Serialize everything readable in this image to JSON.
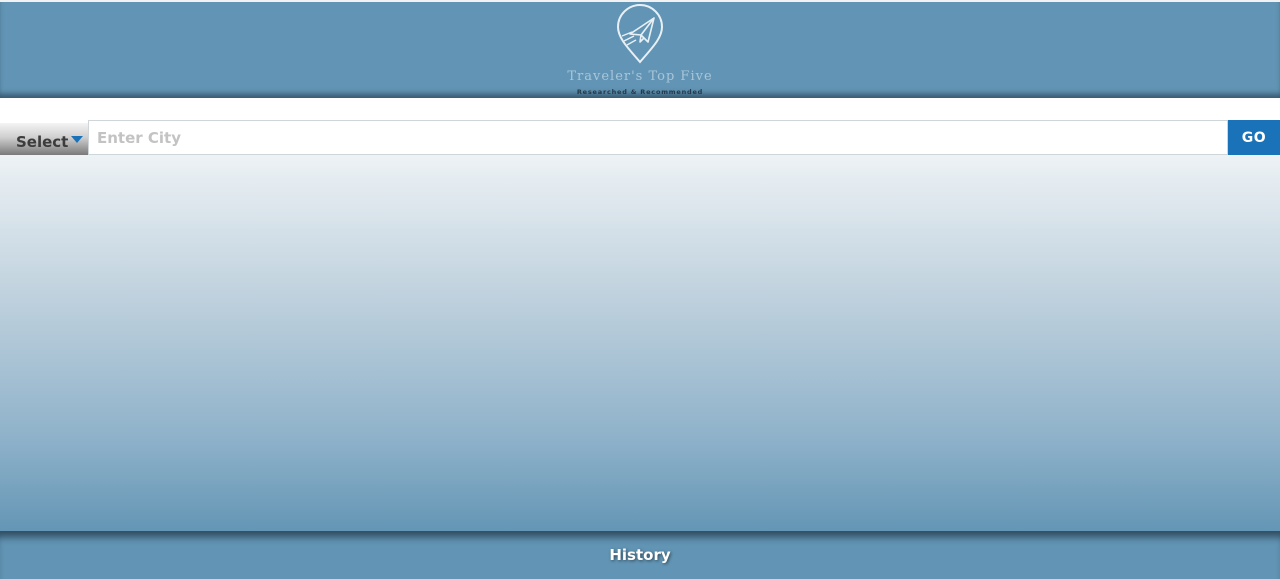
{
  "header": {
    "logo_title": "Traveler's Top Five",
    "logo_subtitle": "Researched & Recommended",
    "logo_icon": "paper-plane-pin-icon"
  },
  "search": {
    "select_label": "Select",
    "city_placeholder": "Enter City",
    "city_value": "",
    "go_label": "GO"
  },
  "footer": {
    "history_label": "History"
  },
  "colors": {
    "header_bg": "#6295b5",
    "accent_blue": "#1a73b8",
    "main_gradient_top": "#edf2f5",
    "main_gradient_bottom": "#6496b5"
  }
}
